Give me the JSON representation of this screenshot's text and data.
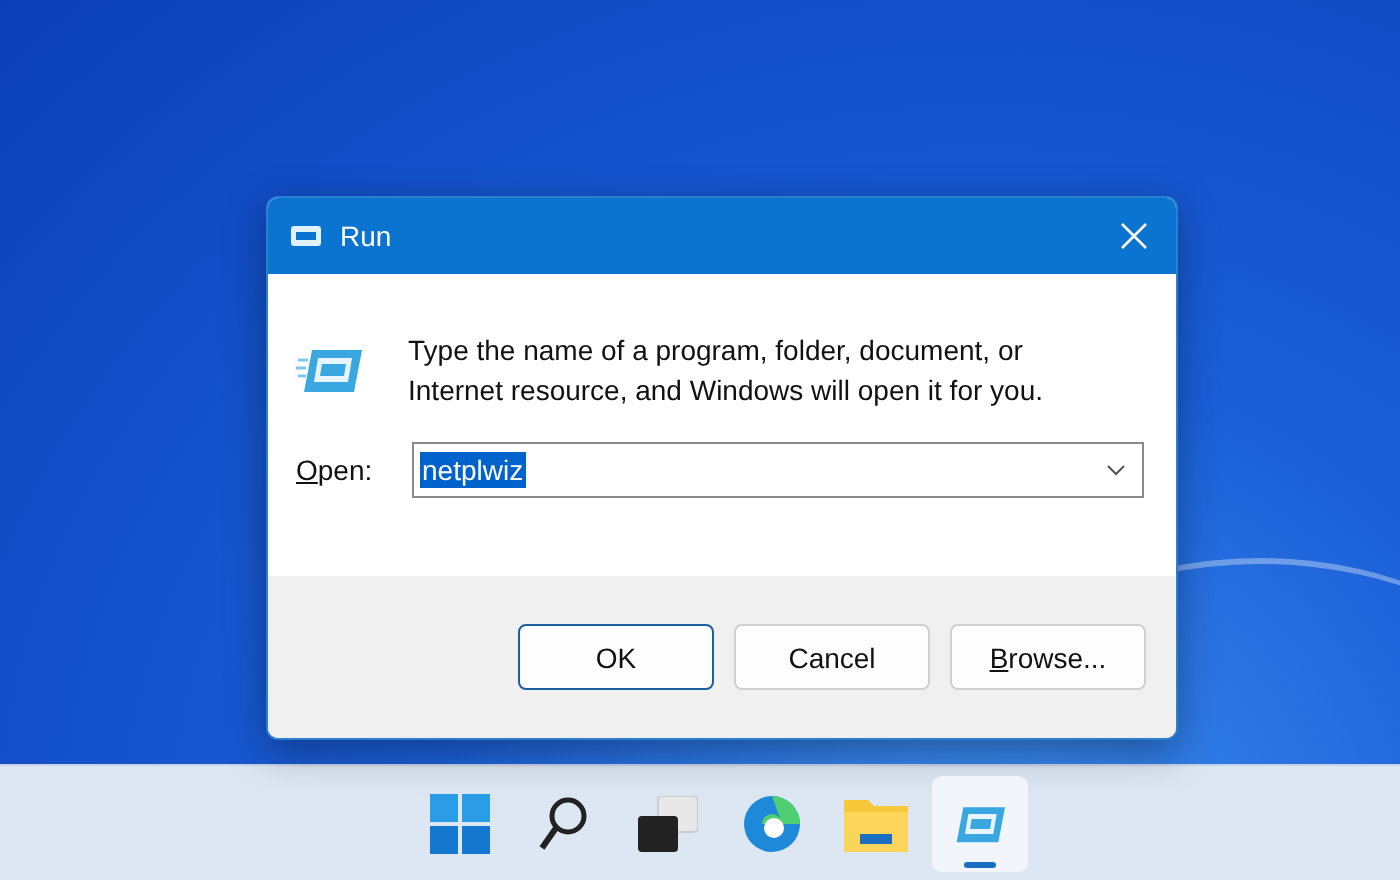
{
  "dialog": {
    "title": "Run",
    "message": "Type the name of a program, folder, document, or Internet resource, and Windows will open it for you.",
    "open_label": {
      "text": "Open:",
      "first_letter_underlined": true
    },
    "command": {
      "value": "netplwiz",
      "highlighted": true
    },
    "buttons": [
      {
        "label": "OK",
        "first_letter_underlined": false,
        "kind": "default"
      },
      {
        "label": "Cancel",
        "first_letter_underlined": false,
        "kind": "normal"
      },
      {
        "label": "Browse...",
        "first_letter_underlined": true,
        "kind": "normal"
      }
    ]
  },
  "taskbar": {
    "items": [
      {
        "kind": "start",
        "selected": false
      },
      {
        "kind": "search",
        "selected": false
      },
      {
        "kind": "taskview",
        "selected": false
      },
      {
        "kind": "edge",
        "selected": false
      },
      {
        "kind": "explorer",
        "selected": false
      },
      {
        "kind": "run",
        "selected": true
      }
    ]
  }
}
